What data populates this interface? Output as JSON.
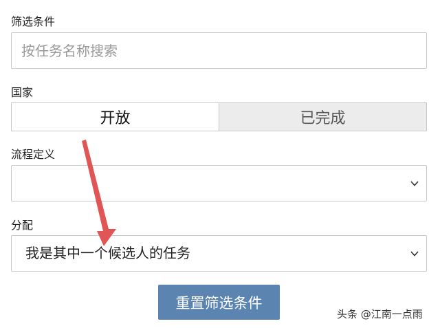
{
  "filter": {
    "label": "筛选条件",
    "search_placeholder": "按任务名称搜索"
  },
  "country": {
    "label": "国家",
    "options": [
      "开放",
      "已完成"
    ],
    "selected": "开放"
  },
  "process": {
    "label": "流程定义",
    "value": ""
  },
  "assign": {
    "label": "分配",
    "value": "我是其中一个候选人的任务"
  },
  "reset_button": "重置筛选条件",
  "watermark": "头条 @江南一点雨",
  "colors": {
    "button_bg": "#5b84b1",
    "arrow": "#e05555",
    "inactive_toggle_bg": "#ececec",
    "border": "#c9c9c9"
  }
}
